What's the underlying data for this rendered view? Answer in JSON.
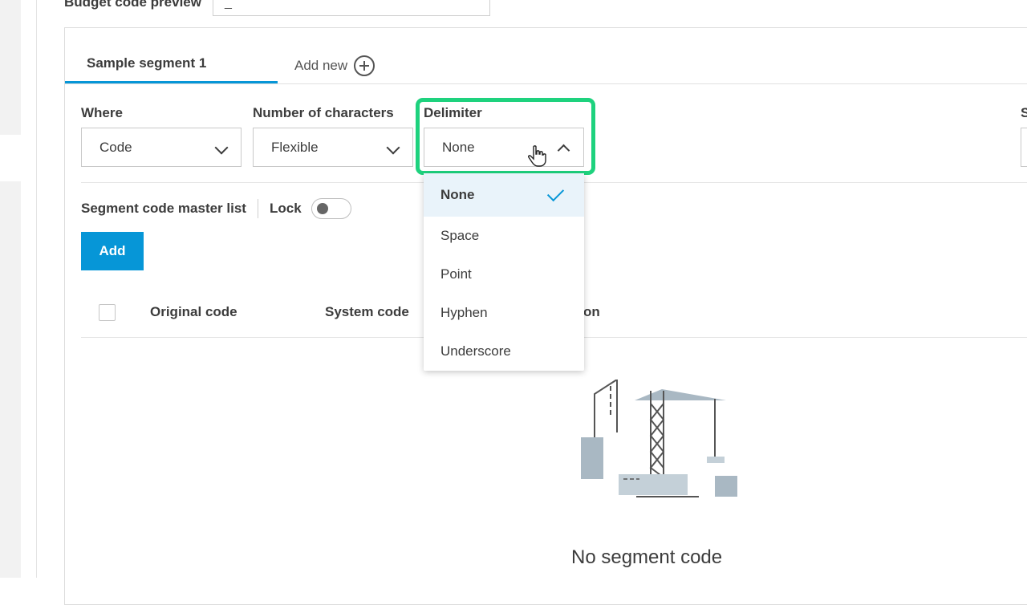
{
  "top": {
    "preview_label": "Budget code preview",
    "preview_value": "_"
  },
  "tabs": {
    "active": "Sample segment 1",
    "add_new": "Add new"
  },
  "fields": {
    "where_label": "Where",
    "where_value": "Code",
    "chars_label": "Number of characters",
    "chars_value": "Flexible",
    "delimiter_label": "Delimiter",
    "delimiter_value": "None",
    "partial_label": "S"
  },
  "master": {
    "label": "Segment code master list",
    "lock_label": "Lock",
    "add_button": "Add"
  },
  "table": {
    "columns": [
      "Original code",
      "System code",
      "on"
    ]
  },
  "dropdown": {
    "options": [
      "None",
      "Space",
      "Point",
      "Hyphen",
      "Underscore"
    ],
    "selected": "None"
  },
  "empty": {
    "message": "No segment code"
  },
  "colors": {
    "accent": "#0696d7",
    "highlight": "#1ed27e",
    "selected_bg": "#e9f3fa"
  },
  "icons": [
    "plus-circle-icon",
    "chevron-down-icon",
    "chevron-up-icon",
    "checkmark-icon",
    "hand-pointer-icon",
    "construction-illustration"
  ]
}
